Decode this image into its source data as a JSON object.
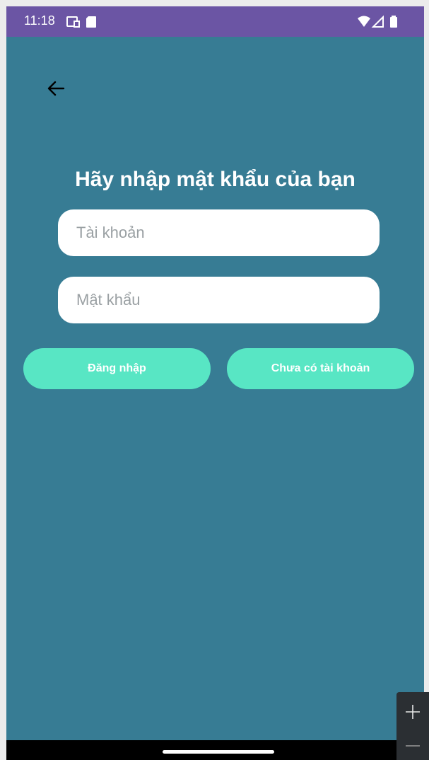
{
  "status_bar": {
    "time": "11:18",
    "left_icons": [
      "screen-icon",
      "sd-card-icon"
    ],
    "right_icons": [
      "wifi-icon",
      "cell-signal-icon",
      "battery-icon"
    ],
    "color": "#6b55a4"
  },
  "header": {
    "back_icon": "arrow-left-icon"
  },
  "main": {
    "title": "Hãy nhập mật khẩu của bạn",
    "username_placeholder": "Tài khoản",
    "password_placeholder": "Mật khẩu",
    "login_label": "Đăng nhập",
    "register_label": "Chưa có tài khoản",
    "background_color": "#377c94",
    "button_color": "#58e6c4"
  },
  "emulator_controls": {
    "zoom_in_icon": "plus-icon",
    "zoom_out_icon": "minus-icon"
  }
}
